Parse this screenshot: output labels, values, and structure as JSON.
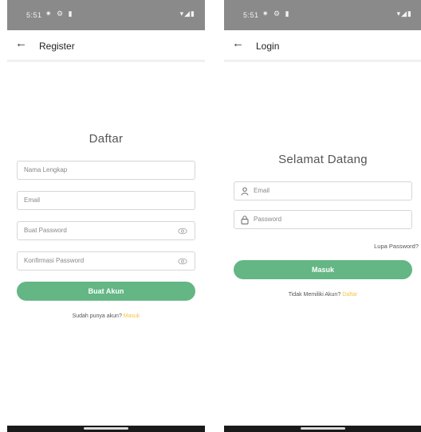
{
  "register": {
    "status": {
      "time": "5:51",
      "left_icons": "✷ ⚙ ▮",
      "right_icons": "▾◢▮"
    },
    "appbar": {
      "title": "Register"
    },
    "heading": "Daftar",
    "fields": {
      "name": {
        "placeholder": "Nama Lengkap"
      },
      "email": {
        "placeholder": "Email"
      },
      "password": {
        "placeholder": "Buat Password"
      },
      "confirm": {
        "placeholder": "Konfirmasi Password"
      }
    },
    "submit_label": "Buat Akun",
    "footer": {
      "prefix": "Sudah punya akun?",
      "link": "Masuk"
    }
  },
  "login": {
    "status": {
      "time": "5:51",
      "left_icons": "✷ ⚙ ▮",
      "right_icons": "▾◢▮"
    },
    "appbar": {
      "title": "Login"
    },
    "heading": "Selamat Datang",
    "fields": {
      "email": {
        "placeholder": "Email"
      },
      "password": {
        "placeholder": "Password"
      }
    },
    "forgot_label": "Lupa Password?",
    "submit_label": "Masuk",
    "footer": {
      "prefix": "Tidak Memiliki Akun?",
      "link": "Daftar"
    }
  },
  "colors": {
    "accent": "#64b684",
    "link": "#f5c542"
  }
}
